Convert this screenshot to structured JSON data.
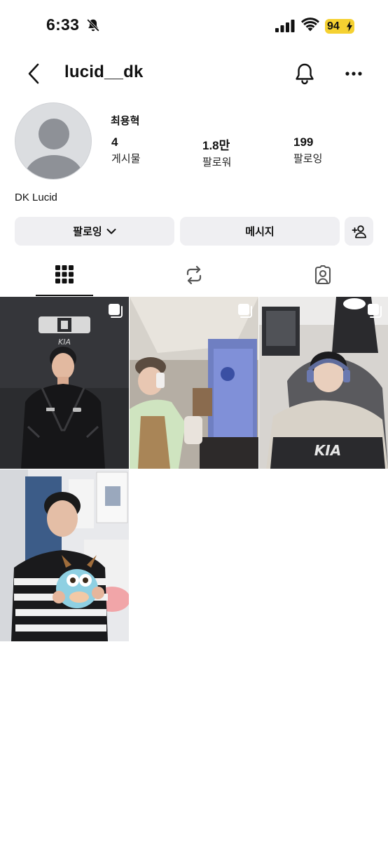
{
  "status_bar": {
    "time": "6:33",
    "battery": "94"
  },
  "header": {
    "username": "lucid__dk"
  },
  "profile": {
    "real_name": "최용혁",
    "stats": [
      {
        "value": "4",
        "label": "게시물"
      },
      {
        "value": "1.8만",
        "label": "팔로워"
      },
      {
        "value": "199",
        "label": "팔로잉"
      }
    ],
    "bio_name": "DK Lucid"
  },
  "actions": {
    "following_label": "팔로잉",
    "message_label": "메시지"
  },
  "tabs": [
    "posts-grid",
    "reels",
    "tagged"
  ],
  "posts_count": 4,
  "colors": {
    "accent_battery": "#f5d131",
    "button_bg": "#efeff2",
    "text": "#111111"
  }
}
